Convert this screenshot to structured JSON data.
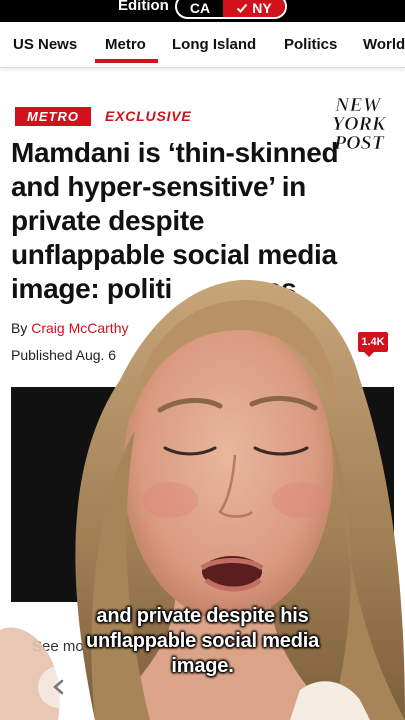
{
  "edition": {
    "label": "Edition",
    "options": [
      {
        "label": "CA",
        "selected": false
      },
      {
        "label": "NY",
        "selected": true
      }
    ]
  },
  "nav": {
    "items": [
      {
        "label": "US News",
        "active": false
      },
      {
        "label": "Metro",
        "active": true
      },
      {
        "label": "Long Island",
        "active": false
      },
      {
        "label": "Politics",
        "active": false
      },
      {
        "label": "World",
        "active": false
      }
    ]
  },
  "article": {
    "section_tag": "METRO",
    "exclusive_tag": "EXCLUSIVE",
    "headline_lines": [
      "Mamdani is ‘thin-skinned",
      "and hyper-sensitive’ in",
      "private despite",
      "unflappable social media",
      "image: politi",
      "rces"
    ],
    "byline_prefix": "By",
    "author": "Craig McCarthy",
    "published": "Published Aug. 6",
    "comment_count": "1.4K",
    "see_more": "See more"
  },
  "logo": {
    "lines": [
      "NEW",
      "YORK",
      "POST"
    ]
  },
  "caption": {
    "lines": [
      "and private despite his",
      "unflappable social media",
      "image."
    ]
  },
  "colors": {
    "brand_red": "#d1111b",
    "text": "#111111"
  },
  "icons": {
    "check": "check-icon",
    "back": "chevron-left-icon"
  }
}
